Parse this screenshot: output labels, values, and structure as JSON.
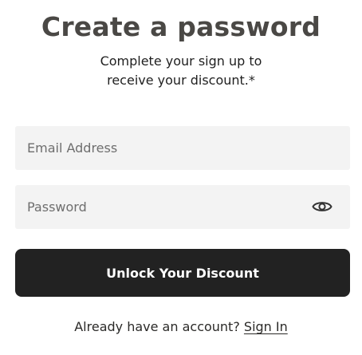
{
  "header": {
    "title": "Create a password",
    "subtitle_line1": "Complete your sign up to",
    "subtitle_line2": "receive your discount.*"
  },
  "form": {
    "email_placeholder": "Email Address",
    "email_value": "",
    "password_placeholder": "Password",
    "password_value": "",
    "password_toggle_icon": "eye-icon",
    "submit_label": "Unlock Your Discount"
  },
  "footer": {
    "prompt": "Already have an account?",
    "signin_label": "Sign In"
  }
}
